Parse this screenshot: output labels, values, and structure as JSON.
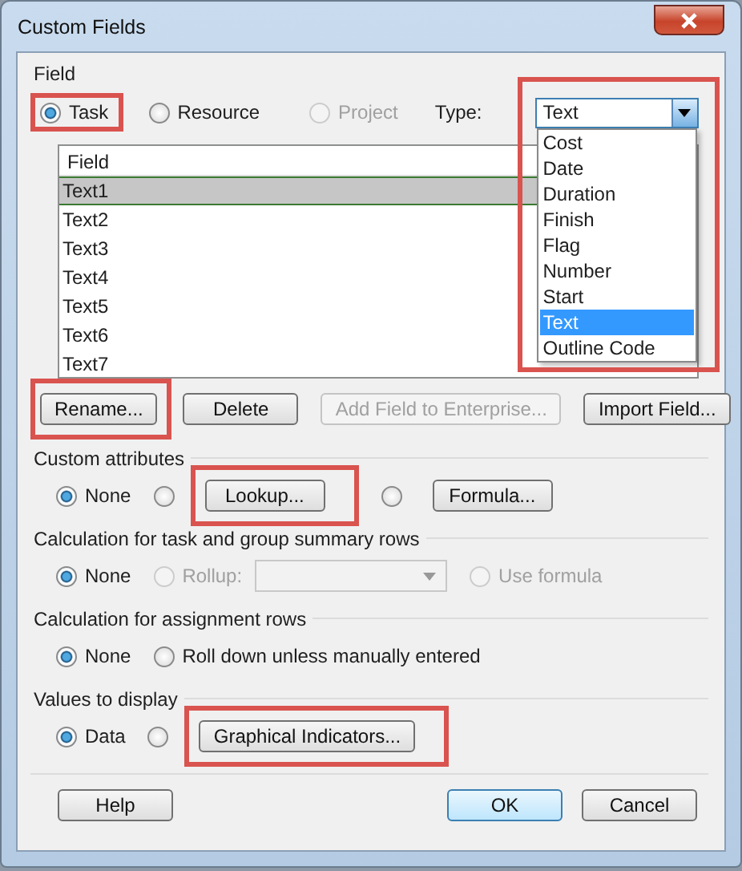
{
  "window": {
    "title": "Custom Fields"
  },
  "field_section": {
    "label": "Field",
    "scopes": [
      {
        "label": "Task",
        "selected": true,
        "disabled": false,
        "highlighted": true
      },
      {
        "label": "Resource",
        "selected": false,
        "disabled": false,
        "highlighted": false
      },
      {
        "label": "Project",
        "selected": false,
        "disabled": true,
        "highlighted": false
      }
    ],
    "type": {
      "label": "Type:",
      "value": "Text",
      "expanded": true,
      "highlighted": true,
      "options": [
        {
          "label": "Cost",
          "selected": false
        },
        {
          "label": "Date",
          "selected": false
        },
        {
          "label": "Duration",
          "selected": false
        },
        {
          "label": "Finish",
          "selected": false
        },
        {
          "label": "Flag",
          "selected": false
        },
        {
          "label": "Number",
          "selected": false
        },
        {
          "label": "Start",
          "selected": false
        },
        {
          "label": "Text",
          "selected": true
        },
        {
          "label": "Outline Code",
          "selected": false
        }
      ]
    }
  },
  "field_list": {
    "header": "Field",
    "rows": [
      {
        "label": "Text1",
        "selected": true
      },
      {
        "label": "Text2",
        "selected": false
      },
      {
        "label": "Text3",
        "selected": false
      },
      {
        "label": "Text4",
        "selected": false
      },
      {
        "label": "Text5",
        "selected": false
      },
      {
        "label": "Text6",
        "selected": false
      },
      {
        "label": "Text7",
        "selected": false
      }
    ]
  },
  "field_buttons": [
    {
      "label": "Rename...",
      "disabled": false,
      "highlighted": true
    },
    {
      "label": "Delete",
      "disabled": false,
      "highlighted": false
    },
    {
      "label": "Add Field to Enterprise...",
      "disabled": true,
      "highlighted": false
    },
    {
      "label": "Import Field...",
      "disabled": false,
      "highlighted": false
    }
  ],
  "sections": [
    {
      "title": "Custom attributes",
      "options": [
        {
          "kind": "radio",
          "label": "None",
          "selected": true
        },
        {
          "kind": "radio-button",
          "label": "Lookup...",
          "selected": false,
          "highlighted": true
        },
        {
          "kind": "radio-button",
          "label": "Formula...",
          "selected": false,
          "highlighted": false
        }
      ]
    },
    {
      "title": "Calculation for task and group summary rows",
      "options": [
        {
          "kind": "radio",
          "label": "None",
          "selected": true,
          "disabled": false
        },
        {
          "kind": "radio-combo",
          "label": "Rollup:",
          "selected": false,
          "disabled": true
        },
        {
          "kind": "radio",
          "label": "Use formula",
          "selected": false,
          "disabled": true
        }
      ]
    },
    {
      "title": "Calculation for assignment rows",
      "options": [
        {
          "kind": "radio",
          "label": "None",
          "selected": true
        },
        {
          "kind": "radio",
          "label": "Roll down unless manually entered",
          "selected": false
        }
      ]
    },
    {
      "title": "Values to display",
      "options": [
        {
          "kind": "radio",
          "label": "Data",
          "selected": true
        },
        {
          "kind": "radio-button",
          "label": "Graphical Indicators...",
          "selected": false,
          "highlighted": true
        }
      ]
    }
  ],
  "footer_buttons": [
    {
      "label": "Help",
      "default": false
    },
    {
      "label": "OK",
      "default": true
    },
    {
      "label": "Cancel",
      "default": false
    }
  ]
}
